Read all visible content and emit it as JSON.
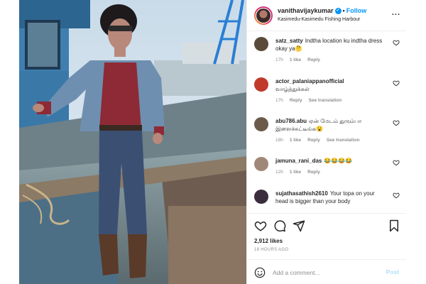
{
  "post": {
    "username": "vanithavijaykumar",
    "follow_label": "Follow",
    "dot": "•",
    "location": "Kasimedu-Kasimedu Fishing Harbour",
    "more_label": "..."
  },
  "comments": [
    {
      "user": "satz_satty",
      "text": "Indtha location ku indtha dress okay ya🤔",
      "time": "17h",
      "likes": "1 like",
      "reply": "Reply",
      "translation": "",
      "avatar_color": "#5a4a3a"
    },
    {
      "user": "actor_palaniappanofficial",
      "text": "வாழ்த்துக்கள்",
      "time": "17h",
      "likes": "",
      "reply": "Reply",
      "translation": "See translation",
      "avatar_color": "#c0392b"
    },
    {
      "user": "abu786.abu",
      "text": "ஏன் மேடம் துரும்பா இளைச்சுட்டீங்க😮",
      "time": "18h",
      "likes": "1 like",
      "reply": "Reply",
      "translation": "See translation",
      "avatar_color": "#6b5a4a"
    },
    {
      "user": "jamuna_rani_das",
      "text": "😂😂😂😂",
      "time": "12h",
      "likes": "1 like",
      "reply": "Reply",
      "translation": "",
      "avatar_color": "#a08878"
    },
    {
      "user": "sujathasathish2610",
      "text": "Your topa on your head is bigger than your body",
      "time": "",
      "likes": "",
      "reply": "",
      "translation": "",
      "avatar_color": "#3a2e3e"
    }
  ],
  "stats": {
    "likes": "2,912 likes",
    "time": "18 HOURS AGO"
  },
  "add_comment": {
    "placeholder": "Add a comment...",
    "post_label": "Post"
  },
  "colors": {
    "accent": "#0095f6",
    "post_disabled": "#b2dffc",
    "muted": "#8e8e8e"
  },
  "icons": [
    "more-icon",
    "heart-icon",
    "comment-icon",
    "share-icon",
    "bookmark-icon",
    "emoji-icon",
    "verified-icon"
  ]
}
